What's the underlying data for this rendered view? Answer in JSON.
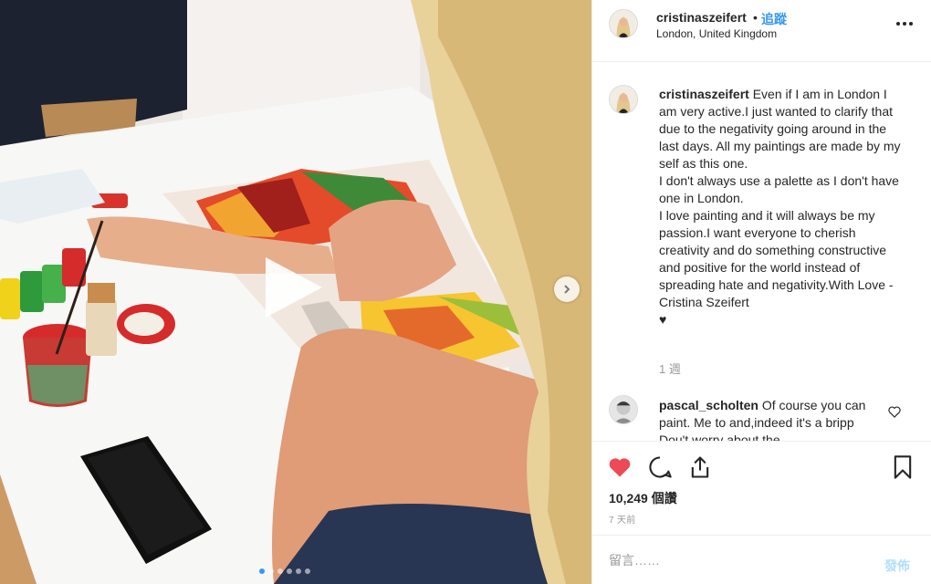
{
  "header": {
    "username": "cristinaszeifert",
    "separator": "•",
    "follow_label": "追蹤",
    "location": "London, United Kingdom"
  },
  "caption": {
    "username": "cristinaszeifert",
    "line1": "Even if I am in London I am very active.I just wanted to clarify that due to the negativity going around in the last days. All my paintings are made by my self as this one.",
    "line2": "I don't always use a palette as I don't have one in London.",
    "line3": "I love painting and it will always be my passion.I want everyone to cherish creativity and do something constructive and positive for the world instead of spreading hate and negativity.With Love - Cristina Szeifert",
    "heart": "♥",
    "time_ago": "1 週"
  },
  "comment": {
    "username": "pascal_scholten",
    "text": "Of course you can paint. Me to and,indeed it's",
    "text_cut": "a bripp Dou't worry about the"
  },
  "actions": {
    "likes": "10,249 個讚",
    "timestamp": "7 天前"
  },
  "add_comment": {
    "placeholder": "留言……",
    "post_label": "發佈"
  },
  "carousel": {
    "total_slides": 6,
    "active_slide": 1
  },
  "colors": {
    "accent": "#3897f0",
    "like_red": "#ed4956",
    "post_disabled": "#b2dffc"
  },
  "icons": {
    "play": "play-icon",
    "next": "chevron-right-icon",
    "more": "more-horizontal-icon",
    "like": "heart-filled-icon",
    "comment": "comment-bubble-icon",
    "share": "share-icon",
    "save": "bookmark-icon"
  }
}
